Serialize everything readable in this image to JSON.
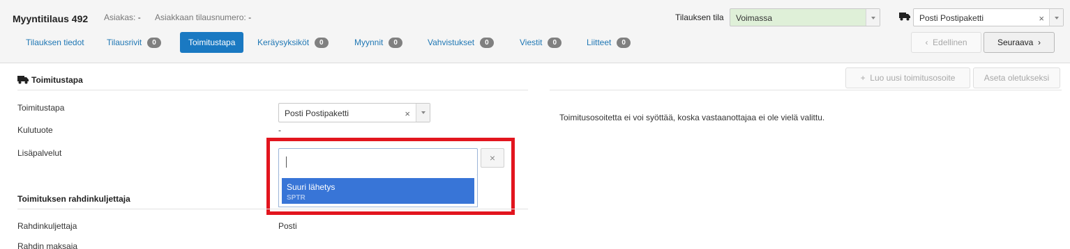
{
  "header": {
    "title": "Myyntitilaus 492",
    "customer_label": "Asiakas:",
    "customer_value": "-",
    "customer_order_label": "Asiakkaan tilausnumero:",
    "customer_order_value": "-",
    "state_label": "Tilauksen tila",
    "state_value": "Voimassa",
    "state_color": "#dff0d8",
    "shipping_value": "Posti Postipaketti",
    "clear_glyph": "×"
  },
  "tabs": [
    {
      "label": "Tilauksen tiedot"
    },
    {
      "label": "Tilausrivit",
      "badge": "0"
    },
    {
      "label": "Toimitustapa"
    },
    {
      "label": "Keräysyksiköt",
      "badge": "0"
    },
    {
      "label": "Myynnit",
      "badge": "0"
    },
    {
      "label": "Vahvistukset",
      "badge": "0"
    },
    {
      "label": "Viestit",
      "badge": "0"
    },
    {
      "label": "Liitteet",
      "badge": "0"
    }
  ],
  "nav": {
    "prev_label": "Edellinen",
    "next_label": "Seuraava",
    "prev_glyph": "‹",
    "next_glyph": "›"
  },
  "shipping_section": {
    "title": "Toimitustapa",
    "method_label": "Toimitustapa",
    "method_value": "Posti Postipaketti",
    "product_label": "Kulutuote",
    "product_value": "-",
    "services_label": "Lisäpalvelut",
    "service_clear_glyph": "×"
  },
  "service_dropdown": {
    "options": [
      {
        "name": "Suuri lähetys",
        "code": "SPTR"
      }
    ],
    "highlight_color": "#3875d7",
    "annotation_color": "#e2151e"
  },
  "carrier_section": {
    "title": "Toimituksen rahdinkuljettaja",
    "carrier_label": "Rahdinkuljettaja",
    "carrier_value": "Posti",
    "payer_label": "Rahdin maksaja"
  },
  "address_panel": {
    "new_address_label": "Luo uusi toimitusosoite",
    "new_address_glyph": "+",
    "set_default_label": "Aseta oletukseksi",
    "info_text": "Toimitusosoitetta ei voi syöttää, koska vastaanottajaa ei ole vielä valittu."
  }
}
